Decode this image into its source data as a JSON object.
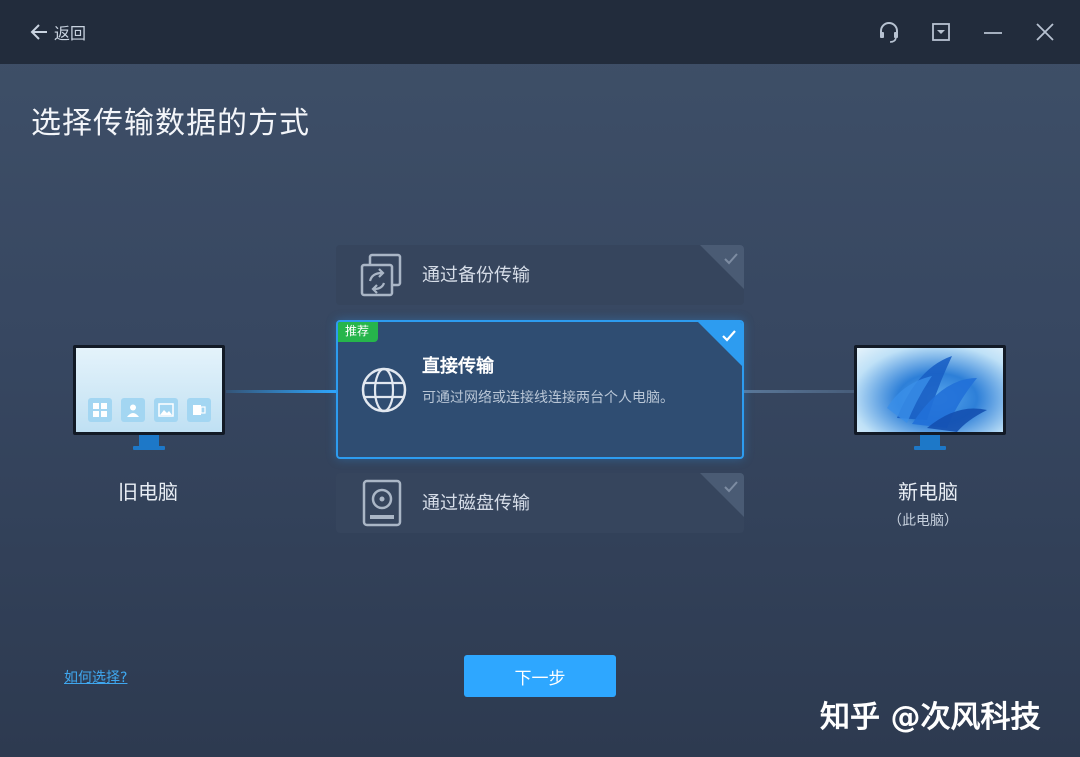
{
  "titlebar": {
    "back_label": "返回",
    "icons": [
      "back-arrow-icon",
      "headset-icon",
      "dropdown-menu-icon",
      "minimize-icon",
      "close-icon"
    ]
  },
  "page_title": "选择传输数据的方式",
  "old_pc": {
    "label": "旧电脑"
  },
  "new_pc": {
    "label": "新电脑",
    "sublabel": "（此电脑）"
  },
  "options": {
    "backup": {
      "label": "通过备份传输",
      "icon": "backup-transfer-icon"
    },
    "direct": {
      "badge": "推荐",
      "title": "直接传输",
      "description": "可通过网络或连接线连接两台个人电脑。",
      "icon": "globe-icon"
    },
    "disk": {
      "label": "通过磁盘传输",
      "icon": "disk-drive-icon"
    }
  },
  "help_link": "如何选择?",
  "next_button": "下一步",
  "watermark": "知乎 @次风科技",
  "colors": {
    "accent": "#2ea7ff",
    "badge": "#26b54b",
    "titlebar": "#222c3c"
  }
}
